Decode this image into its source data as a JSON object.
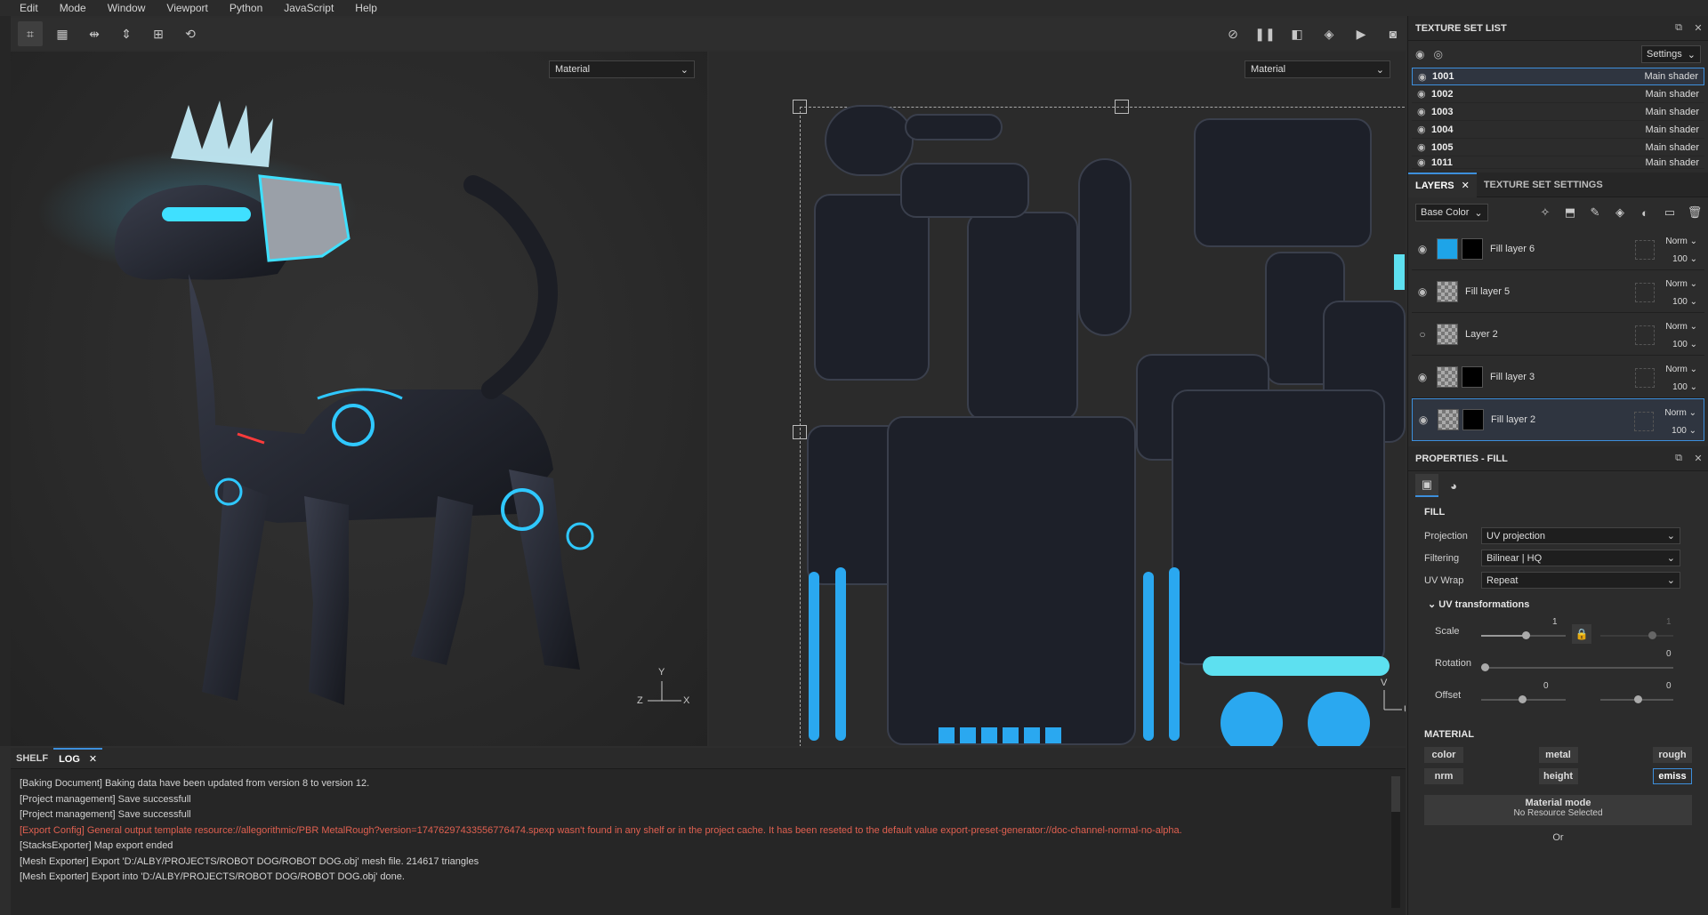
{
  "menu": [
    "Edit",
    "Mode",
    "Window",
    "Viewport",
    "Python",
    "JavaScript",
    "Help"
  ],
  "viewport": {
    "left_mode": "Material",
    "right_mode": "Material"
  },
  "texture_set_list": {
    "title": "TEXTURE SET LIST",
    "settings_label": "Settings",
    "items": [
      {
        "name": "1001",
        "shader": "Main shader"
      },
      {
        "name": "1002",
        "shader": "Main shader"
      },
      {
        "name": "1003",
        "shader": "Main shader"
      },
      {
        "name": "1004",
        "shader": "Main shader"
      },
      {
        "name": "1005",
        "shader": "Main shader"
      },
      {
        "name": "1011",
        "shader": "Main shader"
      }
    ]
  },
  "layers": {
    "tab_layers": "LAYERS",
    "tab_settings": "TEXTURE SET SETTINGS",
    "channel": "Base Color",
    "items": [
      {
        "name": "Fill layer 6",
        "blend": "Norm",
        "opacity": "100"
      },
      {
        "name": "Fill layer 5",
        "blend": "Norm",
        "opacity": "100"
      },
      {
        "name": "Layer 2",
        "blend": "Norm",
        "opacity": "100"
      },
      {
        "name": "Fill layer 3",
        "blend": "Norm",
        "opacity": "100"
      },
      {
        "name": "Fill layer 2",
        "blend": "Norm",
        "opacity": "100"
      }
    ]
  },
  "properties": {
    "title": "PROPERTIES - FILL",
    "fill_title": "FILL",
    "projection_label": "Projection",
    "projection": "UV projection",
    "filtering_label": "Filtering",
    "filtering": "Bilinear | HQ",
    "uvwrap_label": "UV Wrap",
    "uvwrap": "Repeat",
    "uvt_title": "UV transformations",
    "scale_label": "Scale",
    "scale_val": "1",
    "scale_val2": "1",
    "rotation_label": "Rotation",
    "rotation_val": "0",
    "offset_label": "Offset",
    "offset_val1": "0",
    "offset_val2": "0",
    "material_title": "MATERIAL",
    "mat_buttons": [
      "color",
      "metal",
      "rough",
      "nrm",
      "height",
      "emiss"
    ],
    "mat_mode_title": "Material mode",
    "mat_mode_sub": "No Resource Selected",
    "or_label": "Or"
  },
  "log": {
    "tab_shelf": "SHELF",
    "tab_log": "LOG",
    "lines": [
      {
        "text": "[Baking Document] Baking data have been updated from version 8 to version 12.",
        "err": false
      },
      {
        "text": "[Project management] Save successfull",
        "err": false
      },
      {
        "text": "[Project management] Save successfull",
        "err": false
      },
      {
        "text": "[Export Config] General output template resource://allegorithmic/PBR MetalRough?version=17476297433556776474.spexp wasn't found in any shelf or in the project cache. It has been reseted to the default value export-preset-generator://doc-channel-normal-no-alpha.",
        "err": true
      },
      {
        "text": "[StacksExporter] Map export ended",
        "err": false
      },
      {
        "text": "[Mesh Exporter] Export 'D:/ALBY/PROJECTS/ROBOT DOG/ROBOT DOG.obj' mesh file. 214617 triangles",
        "err": false
      },
      {
        "text": "[Mesh Exporter] Export into 'D:/ALBY/PROJECTS/ROBOT DOG/ROBOT DOG.obj' done.",
        "err": false
      }
    ]
  },
  "axes3d": {
    "y": "Y",
    "z": "Z",
    "x": "X"
  },
  "axes2d": {
    "v": "V",
    "u": "U"
  },
  "colors": {
    "accent": "#3d8fdc",
    "error": "#e06050",
    "cyan": "#2aa8f0"
  }
}
